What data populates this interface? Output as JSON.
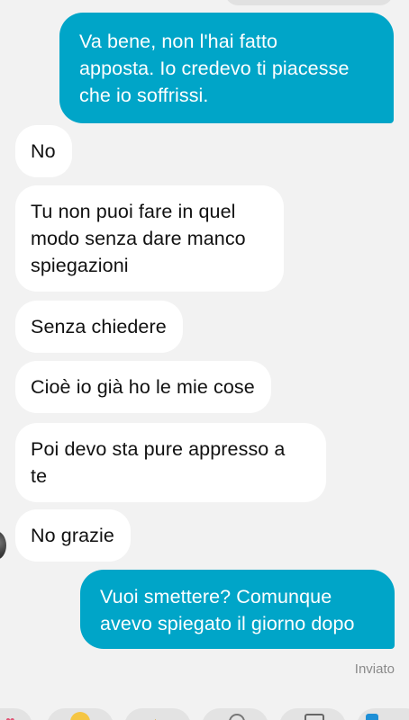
{
  "conversation": {
    "messages": [
      {
        "side": "sent",
        "lines": [
          "Va bene, non l'hai fatto",
          "apposta. Io credevo ti piacesse",
          "che io soffrissi."
        ]
      },
      {
        "side": "received",
        "lines": [
          "No"
        ]
      },
      {
        "side": "received",
        "lines": [
          "Tu non puoi fare in quel",
          "modo senza dare manco",
          "spiegazioni"
        ]
      },
      {
        "side": "received",
        "lines": [
          "Senza chiedere"
        ]
      },
      {
        "side": "received",
        "lines": [
          "Cioè io già ho le mie cose"
        ]
      },
      {
        "side": "received",
        "lines": [
          "Poi devo sta pure appresso a",
          "te"
        ]
      },
      {
        "side": "received",
        "lines": [
          "No grazie"
        ]
      },
      {
        "side": "sent",
        "lines": [
          "Vuoi smettere? Comunque",
          "avevo spiegato il giorno dopo"
        ]
      }
    ],
    "status_text": "Inviato"
  },
  "quick_reactions": {
    "icons": [
      "heart-icon",
      "smile-emoji-icon",
      "thumbs-up-icon",
      "reaction-icon",
      "gif-icon",
      "sticker-icon"
    ]
  },
  "colors": {
    "sent_bubble": "#00a5c8",
    "received_bubble": "#ffffff",
    "background": "#f2f2f2",
    "status_text": "#8a8a8a"
  }
}
